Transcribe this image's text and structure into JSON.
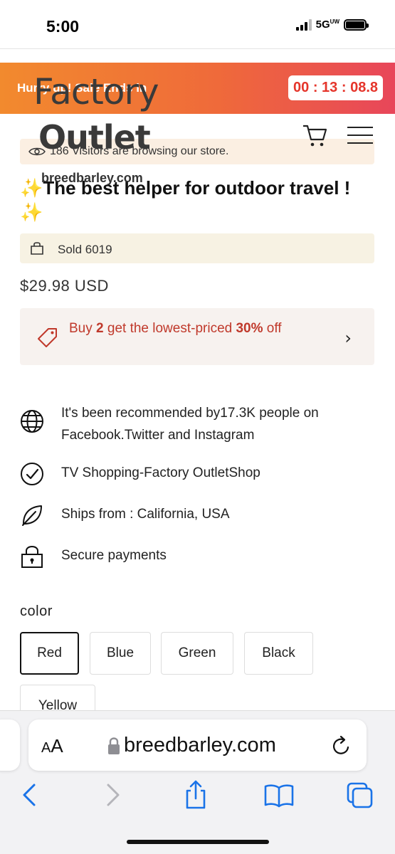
{
  "status": {
    "time": "5:00",
    "network": "5G",
    "network_suffix": "UW"
  },
  "promo": {
    "text": "Hurry up! Sale Ends in",
    "countdown": "00 : 13 : 08.8"
  },
  "logo": {
    "line1": "Factory",
    "line2": "Outlet",
    "domain": "breedbarley.com"
  },
  "visitors": {
    "text": "186 Visitors are browsing our store."
  },
  "product": {
    "title_sparkle": "✨",
    "title": "The best helper for outdoor travel !",
    "sold": "Sold 6019",
    "price": "$29.98 USD"
  },
  "discount": {
    "text_pre": "Buy ",
    "qty": "2",
    "text_mid": " get the lowest-priced ",
    "pct": "30%",
    "text_post": " off"
  },
  "features": [
    {
      "icon": "globe-icon",
      "text": "It's been recommended by17.3K people on Facebook.Twitter and Instagram"
    },
    {
      "icon": "check-circle-icon",
      "text": "TV Shopping-Factory OutletShop"
    },
    {
      "icon": "leaf-icon",
      "text": "Ships from : California, USA"
    },
    {
      "icon": "lock-icon",
      "text": "Secure payments"
    }
  ],
  "color": {
    "label": "color",
    "options": [
      "Red",
      "Blue",
      "Green",
      "Black",
      "Yellow"
    ],
    "selected": "Red"
  },
  "browser": {
    "aa": "AA",
    "url": "breedbarley.com"
  },
  "colors": {
    "promo_start": "#f28a2e",
    "promo_end": "#e8465a",
    "countdown": "#e5352b",
    "discount": "#c0392b"
  }
}
